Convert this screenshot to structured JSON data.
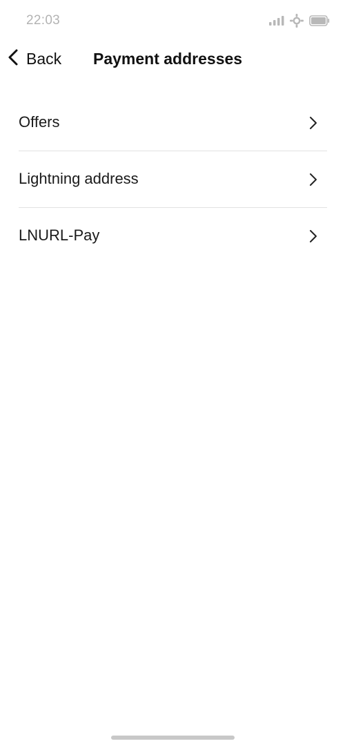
{
  "status_bar": {
    "time": "22:03",
    "icons": [
      "signal-icon",
      "wifi-icon",
      "battery-icon"
    ]
  },
  "nav": {
    "back_label": "Back",
    "title": "Payment addresses"
  },
  "menu": {
    "items": [
      {
        "label": "Offers",
        "icon": "chevron-right-icon"
      },
      {
        "label": "Lightning address",
        "icon": "chevron-right-icon"
      },
      {
        "label": "LNURL-Pay",
        "icon": "chevron-right-icon"
      }
    ]
  },
  "colors": {
    "text": "#111111",
    "status_text": "#b3b3b3",
    "divider": "#e2e2e2",
    "home_indicator": "#c8c8c8",
    "background": "#ffffff"
  }
}
